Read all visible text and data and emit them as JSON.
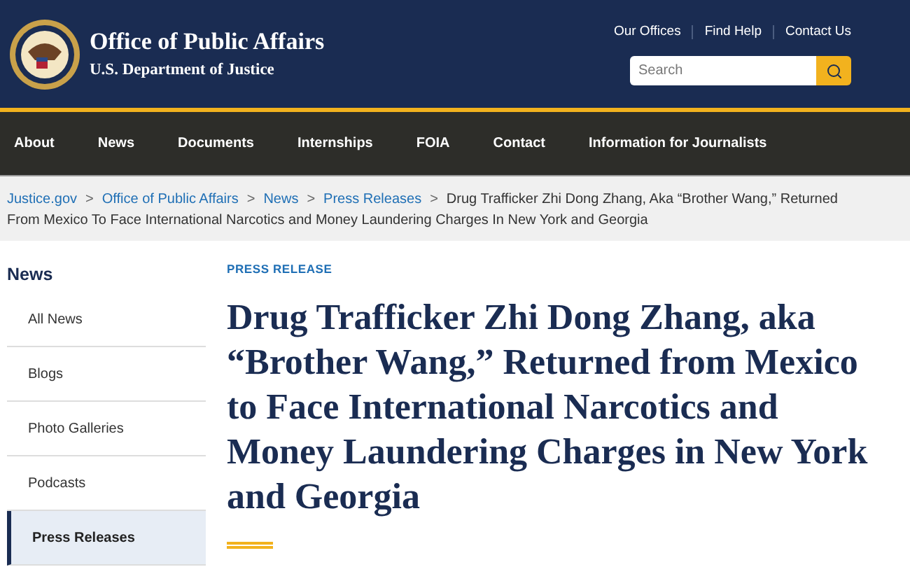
{
  "header": {
    "title": "Office of Public Affairs",
    "subtitle": "U.S. Department of Justice",
    "utility_links": [
      "Our Offices",
      "Find Help",
      "Contact Us"
    ],
    "search": {
      "placeholder": "Search"
    }
  },
  "nav": [
    "About",
    "News",
    "Documents",
    "Internships",
    "FOIA",
    "Contact",
    "Information for Journalists"
  ],
  "breadcrumb": {
    "links": [
      "Justice.gov",
      "Office of Public Affairs",
      "News",
      "Press Releases"
    ],
    "separator": ">",
    "current": "Drug Trafficker Zhi Dong Zhang, Aka “Brother Wang,” Returned From Mexico To Face International Narcotics and Money Laundering Charges In New York and Georgia"
  },
  "sidebar": {
    "title": "News",
    "items": [
      {
        "label": "All News",
        "selected": false
      },
      {
        "label": "Blogs",
        "selected": false
      },
      {
        "label": "Photo Galleries",
        "selected": false
      },
      {
        "label": "Podcasts",
        "selected": false
      },
      {
        "label": "Press Releases",
        "selected": true
      }
    ]
  },
  "article": {
    "kicker": "PRESS RELEASE",
    "title": "Drug Trafficker Zhi Dong Zhang, aka “Brother Wang,” Returned from Mexico to Face International Narcotics and Money Laundering Charges in New York and Georgia"
  }
}
